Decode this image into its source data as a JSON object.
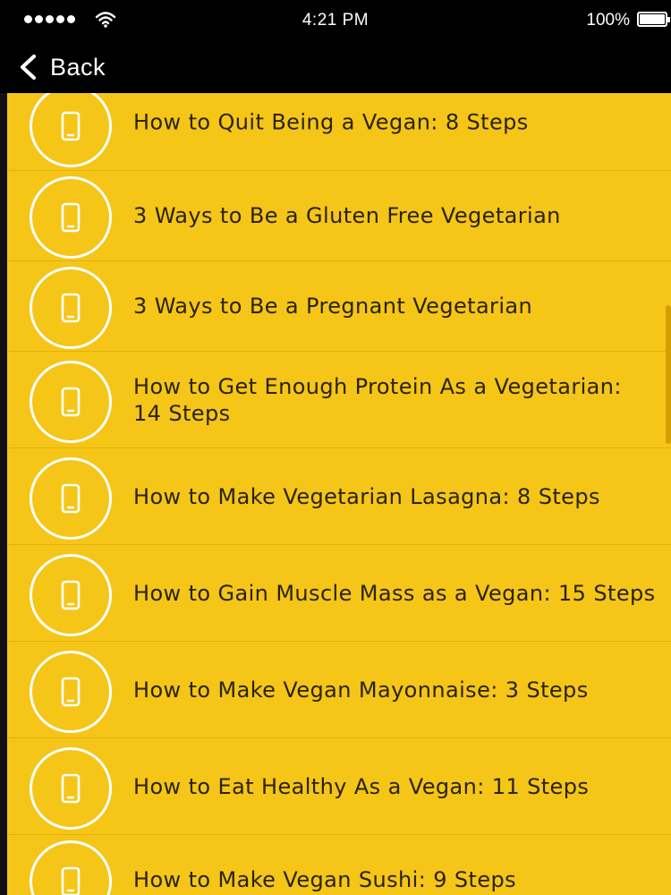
{
  "status_bar": {
    "time": "4:21 PM",
    "battery_percent": "100%",
    "signal_bars": 5,
    "icons": [
      "signal-dots-icon",
      "wifi-icon",
      "battery-icon"
    ]
  },
  "nav": {
    "back_label": "Back",
    "icon": "chevron-left-icon"
  },
  "list": {
    "item_icon": "mobile-phone-icon",
    "items": [
      {
        "label": "How to Quit Being a Vegan: 8 Steps"
      },
      {
        "label": "3 Ways to Be a Gluten Free Vegetarian"
      },
      {
        "label": "3 Ways to Be a Pregnant Vegetarian"
      },
      {
        "label": "How to Get Enough Protein As a Vegetarian: 14 Steps"
      },
      {
        "label": "How to Make Vegetarian Lasagna: 8 Steps"
      },
      {
        "label": "How to Gain Muscle Mass as a Vegan: 15 Steps"
      },
      {
        "label": "How to Make Vegan Mayonnaise: 3 Steps"
      },
      {
        "label": "How to Eat Healthy As a Vegan: 11 Steps"
      },
      {
        "label": "How to Make Vegan Sushi: 9 Steps"
      }
    ]
  },
  "colors": {
    "list_background": "#f5c518",
    "bar_background": "#000000",
    "text": "#2a2410",
    "icon_stroke": "#ffffff"
  }
}
